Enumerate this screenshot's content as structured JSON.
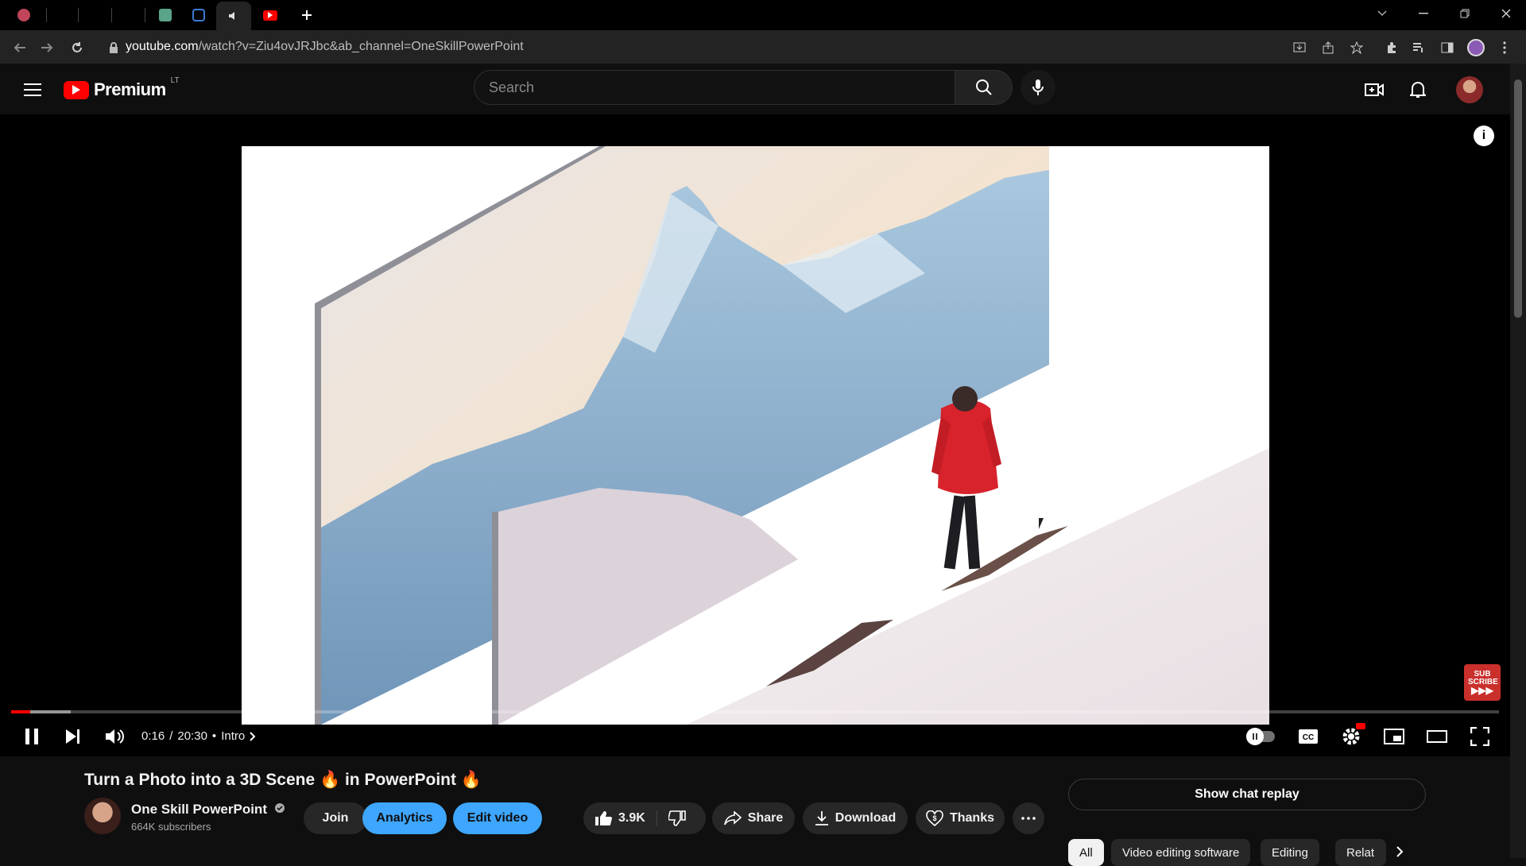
{
  "browser": {
    "url_host": "youtube.com",
    "url_rest": "/watch?v=Ziu4ovJRJbc&ab_channel=OneSkillPowerPoint"
  },
  "header": {
    "logo_text": "Premium",
    "region": "LT",
    "search_placeholder": "Search"
  },
  "player": {
    "current_time": "0:16",
    "duration": "20:30",
    "chapter": "Intro",
    "progress_fraction": 0.013,
    "buffered_fraction": 0.04,
    "subscribe_badge": "SUB SCRIBE"
  },
  "video": {
    "title": "Turn a Photo into a 3D Scene 🔥 in PowerPoint 🔥",
    "channel": "One Skill PowerPoint",
    "subscribers": "664K subscribers",
    "join": "Join",
    "analytics": "Analytics",
    "edit_video": "Edit video",
    "likes": "3.9K",
    "share": "Share",
    "download": "Download",
    "thanks": "Thanks"
  },
  "chat": {
    "show_replay": "Show chat replay"
  },
  "chips": [
    "All",
    "Video editing software",
    "Editing",
    "Relat"
  ],
  "colors": {
    "accent_red": "#ff0000",
    "accent_blue": "#3ea6ff"
  }
}
